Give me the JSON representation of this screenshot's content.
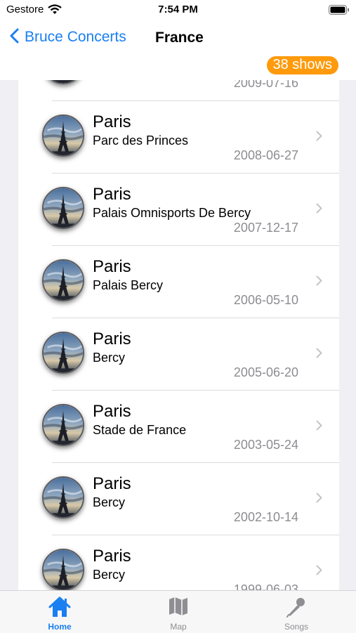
{
  "status_bar": {
    "carrier": "Gestore",
    "time": "7:54 PM"
  },
  "nav": {
    "back_label": "Bruce Concerts",
    "title": "France",
    "badge": "38 shows"
  },
  "list": {
    "partial_top_date": "2009-07-16",
    "rows": [
      {
        "city": "Paris",
        "venue": "Parc des Princes",
        "date": "2008-06-27"
      },
      {
        "city": "Paris",
        "venue": "Palais Omnisports De Bercy",
        "date": "2007-12-17"
      },
      {
        "city": "Paris",
        "venue": "Palais Bercy",
        "date": "2006-05-10"
      },
      {
        "city": "Paris",
        "venue": "Bercy",
        "date": "2005-06-20"
      },
      {
        "city": "Paris",
        "venue": "Stade de France",
        "date": "2003-05-24"
      },
      {
        "city": "Paris",
        "venue": "Bercy",
        "date": "2002-10-14"
      },
      {
        "city": "Paris",
        "venue": "Bercy",
        "date": "1999-06-03"
      }
    ]
  },
  "tabs": [
    {
      "label": "Home",
      "icon": "house-icon",
      "selected": true
    },
    {
      "label": "Map",
      "icon": "map-icon",
      "selected": false
    },
    {
      "label": "Songs",
      "icon": "microphone-icon",
      "selected": false
    }
  ],
  "colors": {
    "accent": "#1a7ff0",
    "badge": "#fe9a0b",
    "secondary_text": "#8d8d92"
  }
}
